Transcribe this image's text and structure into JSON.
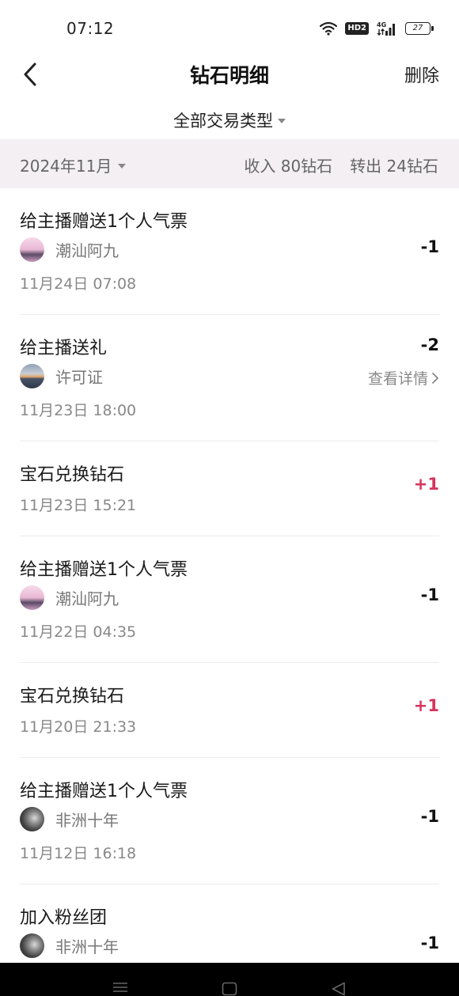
{
  "status": {
    "time": "07:12",
    "battery": "27",
    "network": "4G",
    "hd": "HD2"
  },
  "nav": {
    "title": "钻石明细",
    "delete_label": "删除"
  },
  "filter": {
    "label": "全部交易类型"
  },
  "summary": {
    "month": "2024年11月",
    "income": "收入 80钻石",
    "outgo": "转出 24钻石"
  },
  "records": [
    {
      "title": "给主播赠送1个人气票",
      "user": "潮汕阿九",
      "avatar": "pink",
      "date": "11月24日 07:08",
      "amount": "-1"
    },
    {
      "title": "给主播送礼",
      "user": "许可证",
      "avatar": "sunset",
      "date": "11月23日 18:00",
      "amount": "-2",
      "detail": "查看详情"
    },
    {
      "title": "宝石兑换钻石",
      "date": "11月23日 15:21",
      "amount": "+1"
    },
    {
      "title": "给主播赠送1个人气票",
      "user": "潮汕阿九",
      "avatar": "pink",
      "date": "11月22日 04:35",
      "amount": "-1"
    },
    {
      "title": "宝石兑换钻石",
      "date": "11月20日 21:33",
      "amount": "+1"
    },
    {
      "title": "给主播赠送1个人气票",
      "user": "非洲十年",
      "avatar": "gray",
      "date": "11月12日 16:18",
      "amount": "-1"
    },
    {
      "title": "加入粉丝团",
      "user": "非洲十年",
      "avatar": "gray",
      "amount": "-1"
    }
  ],
  "colors": {
    "accent_plus": "#d6345c",
    "band_bg": "#f3eff2"
  }
}
